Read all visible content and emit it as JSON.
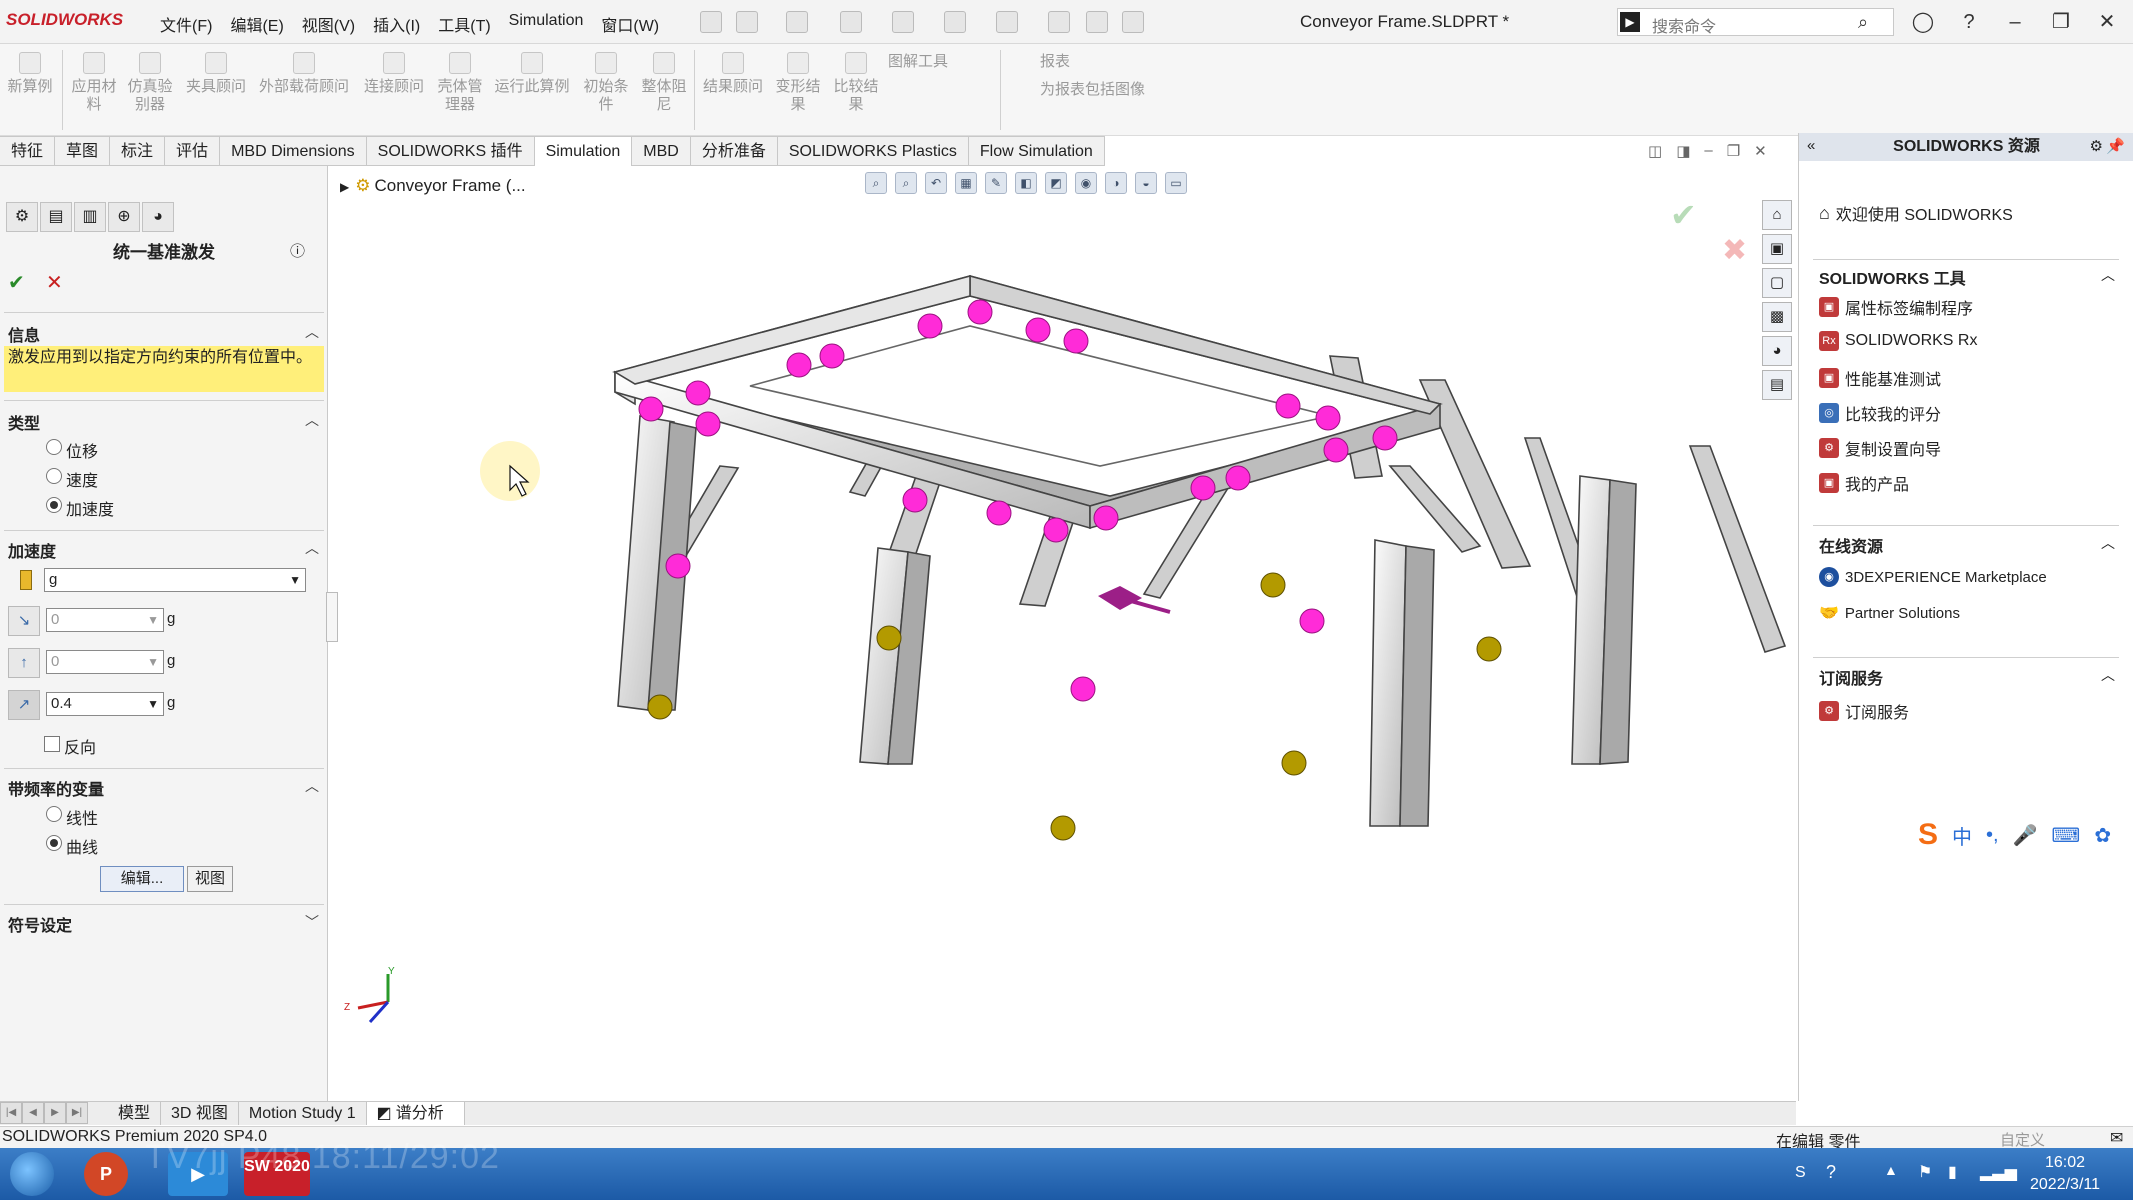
{
  "app": {
    "logo": "SOLIDWORKS",
    "menus": [
      "文件(F)",
      "编辑(E)",
      "视图(V)",
      "插入(I)",
      "工具(T)",
      "Simulation",
      "窗口(W)"
    ],
    "document_title": "Conveyor Frame.SLDPRT *",
    "search_placeholder": "搜索命令"
  },
  "ribbon": {
    "buttons": [
      "新算例",
      "应用材料",
      "仿真验别器",
      "夹具顾问",
      "外部载荷顾问",
      "连接顾问",
      "壳体管理器",
      "运行此算例",
      "初始条件",
      "整体阻尼",
      "结果顾问",
      "变形结果",
      "比较结果"
    ],
    "side_items": [
      "图解工具",
      "报表",
      "为报表包括图像"
    ]
  },
  "command_tabs": [
    "特征",
    "草图",
    "标注",
    "评估",
    "MBD Dimensions",
    "SOLIDWORKS 插件",
    "Simulation",
    "MBD",
    "分析准备",
    "SOLIDWORKS Plastics",
    "Flow Simulation"
  ],
  "active_tab": "Simulation",
  "property_manager": {
    "title": "统一基准激发",
    "info_header": "信息",
    "info_text": "激发应用到以指定方向约束的所有位置中。",
    "type_header": "类型",
    "type_options": [
      "位移",
      "速度",
      "加速度"
    ],
    "type_selected": "加速度",
    "accel_header": "加速度",
    "unit_select": "g",
    "dir_values": [
      "0",
      "0",
      "0.4"
    ],
    "dir_unit": "g",
    "reverse_label": "反向",
    "freq_header": "带频率的变量",
    "freq_options": [
      "线性",
      "曲线"
    ],
    "freq_selected": "曲线",
    "edit_button": "编辑...",
    "view_button": "视图",
    "symbol_header": "符号设定"
  },
  "viewport": {
    "tree_root": "Conveyor Frame (..."
  },
  "resources": {
    "header": "SOLIDWORKS 资源",
    "welcome": "欢迎使用 SOLIDWORKS",
    "tools_header": "SOLIDWORKS 工具",
    "tools": [
      "属性标签编制程序",
      "SOLIDWORKS Rx",
      "性能基准测试",
      "比较我的评分",
      "复制设置向导",
      "我的产品"
    ],
    "online_header": "在线资源",
    "online": [
      "3DEXPERIENCE Marketplace",
      "Partner Solutions"
    ],
    "subscription_header": "订阅服务",
    "subscription": [
      "订阅服务"
    ]
  },
  "bottom_tabs": [
    "模型",
    "3D 视图",
    "Motion Study 1",
    "谱分析"
  ],
  "status": {
    "product": "SOLIDWORKS Premium 2020 SP4.0",
    "mode": "在编辑 零件",
    "custom": "自定义"
  },
  "taskbar": {
    "time": "16:02",
    "date": "2022/3/11",
    "watermark": "TV7jj P48 18:11/29:02",
    "sw_label": "SW 2020"
  },
  "colors": {
    "accent": "#c8202a",
    "highlight": "#ffef7a",
    "point_magenta": "#ff2bd8",
    "point_gold": "#b39a00"
  }
}
